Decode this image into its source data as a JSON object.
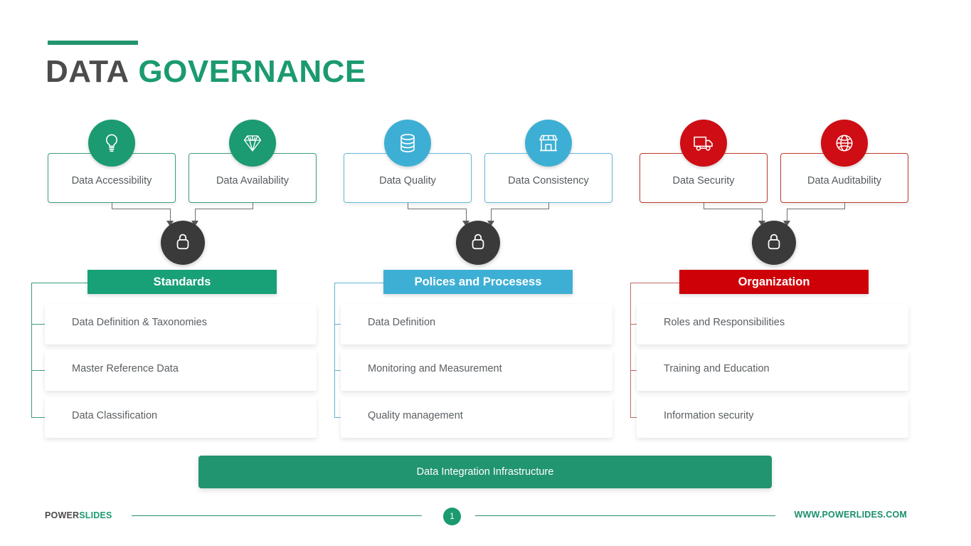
{
  "title": {
    "part1": "DATA",
    "part2": "GOVERNANCE"
  },
  "top_cards": [
    {
      "label": "Data Accessibility",
      "icon": "lightbulb-icon",
      "color": "#1C9A72",
      "theme": "green"
    },
    {
      "label": "Data Availability",
      "icon": "diamond-icon",
      "color": "#1C9A72",
      "theme": "green"
    },
    {
      "label": "Data Quality",
      "icon": "database-icon",
      "color": "#3EAFD4",
      "theme": "blue"
    },
    {
      "label": "Data Consistency",
      "icon": "store-icon",
      "color": "#3EAFD4",
      "theme": "blue"
    },
    {
      "label": "Data Security",
      "icon": "truck-icon",
      "color": "#CE0D14",
      "theme": "red"
    },
    {
      "label": "Data Auditability",
      "icon": "globe-icon",
      "color": "#CE0D14",
      "theme": "red"
    }
  ],
  "lock_icon": "padlock-icon",
  "columns": [
    {
      "header": "Standards",
      "color": "#18A077",
      "theme": "green",
      "items": [
        "Data Definition & Taxonomies",
        "Master Reference Data",
        "Data Classification"
      ]
    },
    {
      "header": "Polices and Procesess",
      "color": "#3EAFD4",
      "theme": "blue",
      "items": [
        "Data Definition",
        "Monitoring and Measurement",
        "Quality management"
      ]
    },
    {
      "header": "Organization",
      "color": "#CE0008",
      "theme": "red",
      "items": [
        "Roles and Responsibilities",
        "Training and Education",
        "Information security"
      ]
    }
  ],
  "bottom_bar": {
    "label": "Data Integration Infrastructure",
    "color": "#219470"
  },
  "footer": {
    "logo_part1": "POWER",
    "logo_part2": "SLIDES",
    "page_number": "1",
    "url": "WWW.POWERLIDES.COM"
  }
}
